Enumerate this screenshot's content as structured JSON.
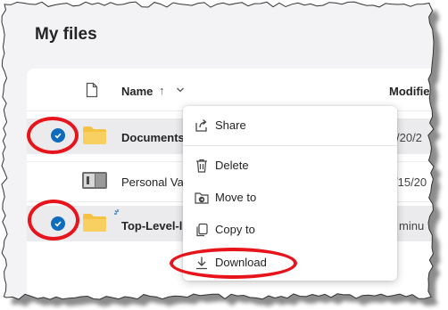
{
  "page": {
    "title": "My files"
  },
  "list_header": {
    "name_label": "Name",
    "sort_arrow": "↑",
    "modified_label": "Modifie",
    "doc_icon": "document-icon",
    "chevron_icon": "chevron-down-icon"
  },
  "rows": [
    {
      "name": "Documents",
      "modified": "/20/2",
      "selected": true,
      "icon": "folder-icon"
    },
    {
      "name": "Personal Va",
      "modified": "/15/20",
      "selected": false,
      "icon": "personal-vault-icon"
    },
    {
      "name": "Top-Level-l",
      "modified": "minu",
      "selected": true,
      "icon": "folder-icon"
    }
  ],
  "context_menu": {
    "items": [
      {
        "label": "Share",
        "icon": "share-icon"
      },
      {
        "label": "Delete",
        "icon": "trash-icon"
      },
      {
        "label": "Move to",
        "icon": "move-to-icon"
      },
      {
        "label": "Copy to",
        "icon": "copy-icon"
      },
      {
        "label": "Download",
        "icon": "download-icon"
      }
    ]
  },
  "colors": {
    "accent": "#0f6cbd",
    "annotation_red": "#e8141c",
    "folder_yellow": "#f5c342",
    "selected_row": "#ebebee"
  }
}
